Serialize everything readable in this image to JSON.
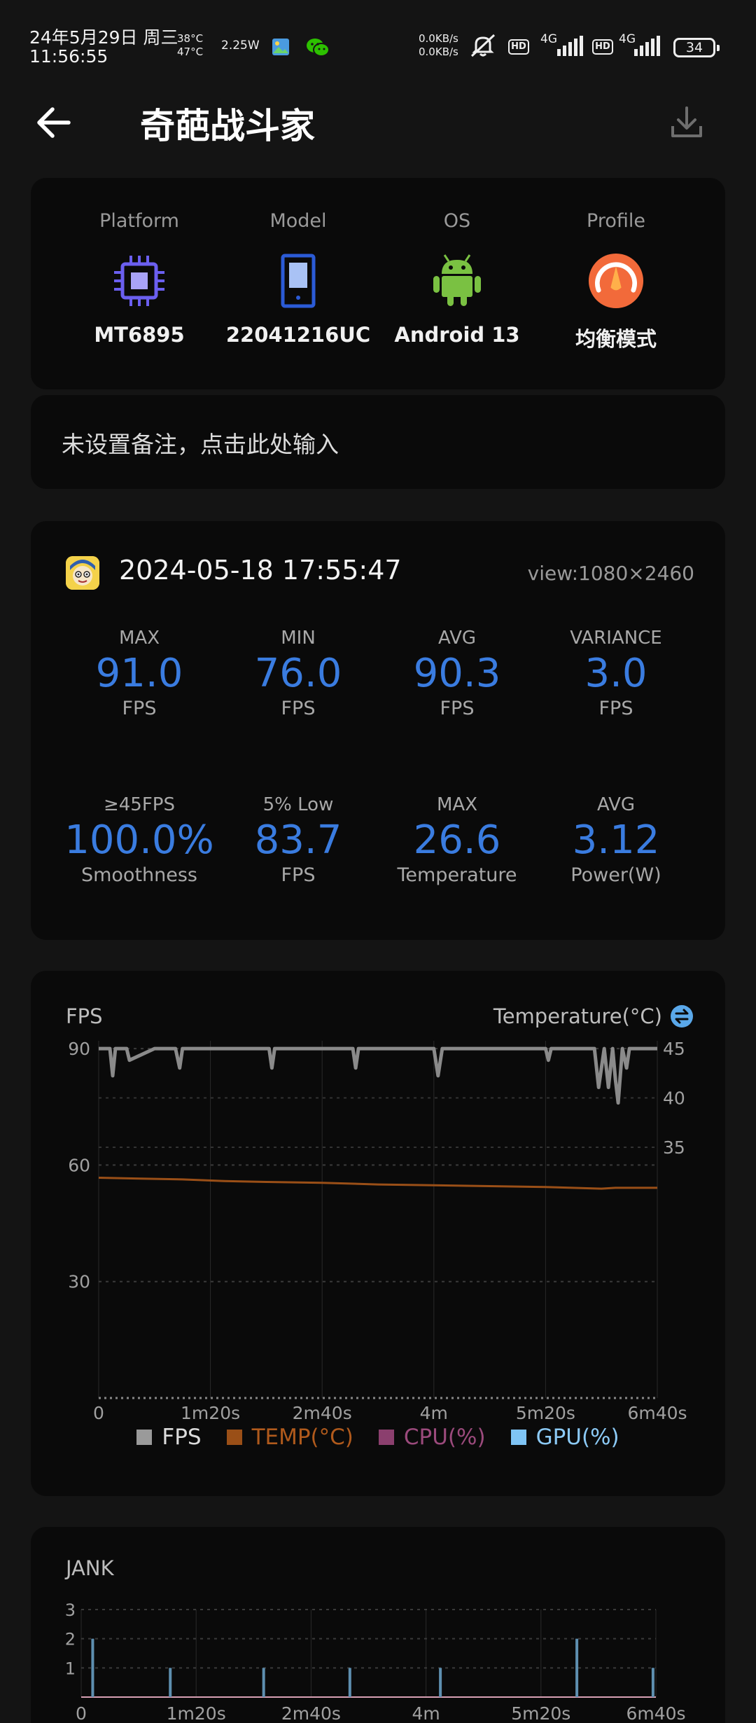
{
  "status_bar": {
    "date": "24年5月29日 周三",
    "time": "11:56:55",
    "temp_top": "38°C",
    "temp_bottom": "47°C",
    "power": "2.25W",
    "up_speed": "0.0KB/s",
    "down_speed": "0.0KB/s",
    "hd": "HD",
    "net": "4G",
    "battery": "34"
  },
  "app_bar": {
    "title": "奇葩战斗家"
  },
  "device": {
    "items": [
      {
        "label": "Platform",
        "value": "MT6895",
        "icon": "chip-icon"
      },
      {
        "label": "Model",
        "value": "22041216UC",
        "icon": "phone-icon"
      },
      {
        "label": "OS",
        "value": "Android 13",
        "icon": "android-icon"
      },
      {
        "label": "Profile",
        "value": "均衡模式",
        "icon": "balanced-mode-icon"
      }
    ],
    "note_placeholder": "未设置备注，点击此处输入"
  },
  "session": {
    "time": "2024-05-18 17:55:47",
    "view": "view:1080×2460"
  },
  "stats": [
    {
      "label": "MAX",
      "value": "91.0",
      "unit": "FPS"
    },
    {
      "label": "MIN",
      "value": "76.0",
      "unit": "FPS"
    },
    {
      "label": "AVG",
      "value": "90.3",
      "unit": "FPS"
    },
    {
      "label": "VARIANCE",
      "value": "3.0",
      "unit": "FPS"
    },
    {
      "label": "≥45FPS",
      "value": "100.0%",
      "unit": "Smoothness"
    },
    {
      "label": "5% Low",
      "value": "83.7",
      "unit": "FPS"
    },
    {
      "label": "MAX",
      "value": "26.6",
      "unit": "Temperature"
    },
    {
      "label": "AVG",
      "value": "3.12",
      "unit": "Power(W)"
    }
  ],
  "colors": {
    "accent": "#3a7ce0",
    "fps": "#8a8a8a",
    "temp": "#9a4f17",
    "cpu": "#8b3f6e",
    "gpu": "#7fc4f4"
  },
  "chart_data": [
    {
      "type": "line",
      "title": "FPS",
      "secondary_axis_label": "Temperature(°C)",
      "x_ticks": [
        "0",
        "1m20s",
        "2m40s",
        "4m",
        "5m20s",
        "6m40s"
      ],
      "y_ticks": [
        "90",
        "60",
        "30"
      ],
      "y2_ticks": [
        "45",
        "40",
        "35"
      ],
      "ylim": [
        0,
        92
      ],
      "xlim_seconds": [
        0,
        400
      ],
      "legend": [
        "FPS",
        "TEMP(°C)",
        "CPU(%)",
        "GPU(%)"
      ],
      "series": [
        {
          "name": "FPS",
          "x": [
            0,
            8,
            10,
            12,
            20,
            22,
            40,
            55,
            58,
            60,
            100,
            122,
            124,
            126,
            165,
            175,
            182,
            184,
            186,
            195,
            210,
            240,
            243,
            246,
            270,
            310,
            320,
            322,
            324,
            335,
            355,
            358,
            362,
            365,
            368,
            370,
            372,
            375,
            378,
            380,
            400
          ],
          "values": [
            90,
            90,
            83,
            90,
            90,
            87,
            90,
            90,
            85,
            90,
            90,
            90,
            85,
            90,
            90,
            90,
            90,
            85,
            90,
            90,
            90,
            90,
            83,
            90,
            90,
            90,
            90,
            87,
            90,
            90,
            90,
            80,
            90,
            80,
            90,
            82,
            76,
            90,
            85,
            90,
            90
          ]
        },
        {
          "name": "TEMP(°C)",
          "x": [
            0,
            30,
            60,
            90,
            120,
            160,
            200,
            240,
            280,
            320,
            360,
            370,
            400
          ],
          "values": [
            26.6,
            26.5,
            26.4,
            26.2,
            26.1,
            26.0,
            25.8,
            25.7,
            25.6,
            25.5,
            25.3,
            25.4,
            25.4
          ]
        }
      ]
    },
    {
      "type": "bar",
      "title": "JANK",
      "x_ticks": [
        "0",
        "1m20s",
        "2m40s",
        "4m",
        "5m20s",
        "6m40s"
      ],
      "y_ticks": [
        "3",
        "2",
        "1",
        "0"
      ],
      "ylim": [
        0,
        3
      ],
      "xlim_seconds": [
        0,
        400
      ],
      "series": [
        {
          "name": "JANK",
          "x": [
            8,
            62,
            127,
            187,
            250,
            345,
            398
          ],
          "values": [
            2,
            1,
            1,
            1,
            1,
            2,
            1
          ]
        }
      ]
    }
  ]
}
